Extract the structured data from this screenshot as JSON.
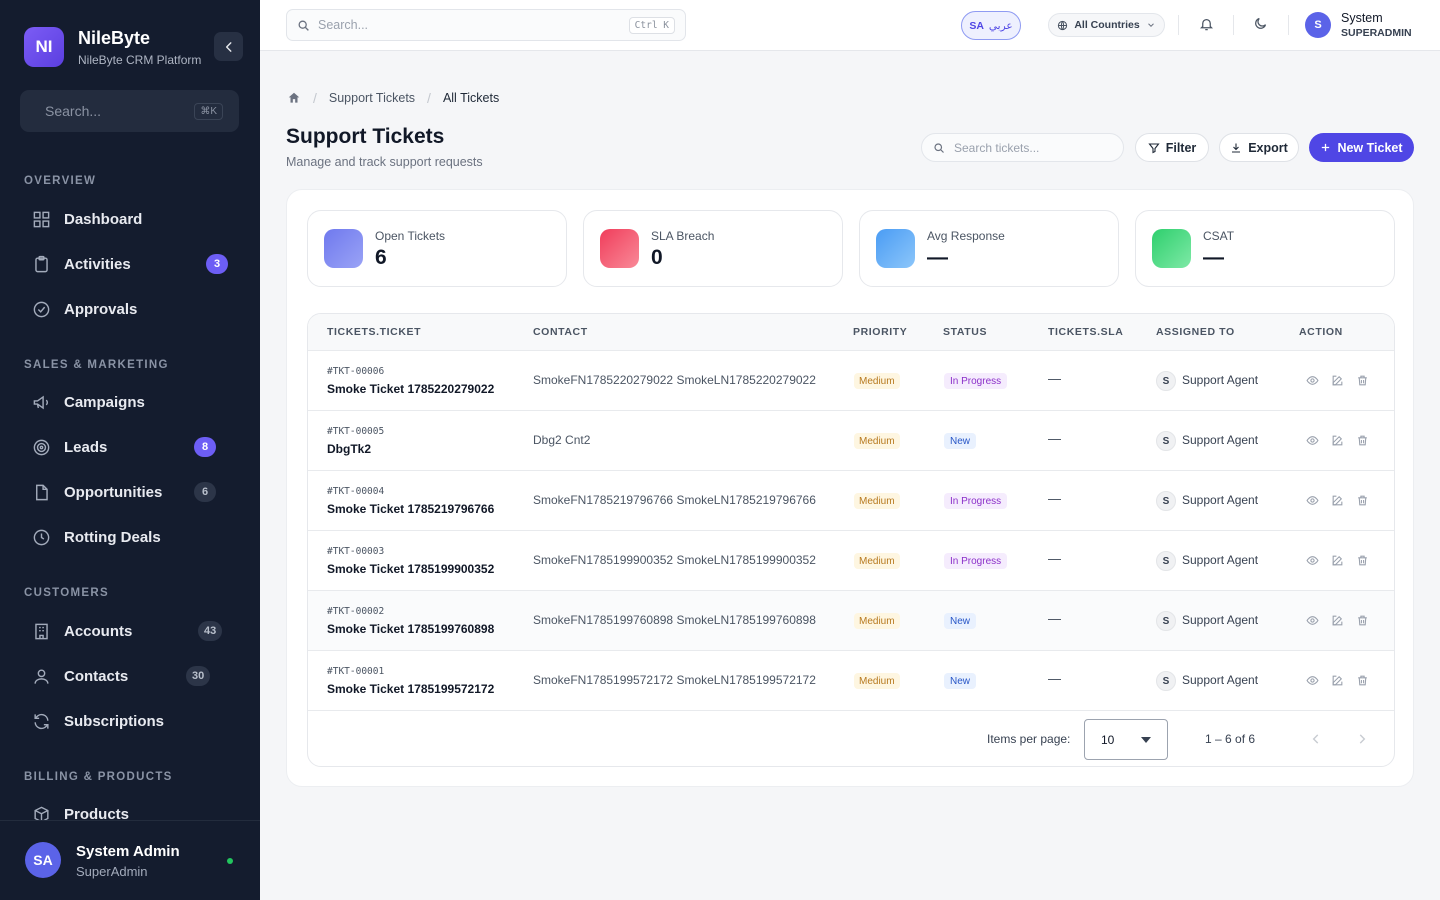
{
  "sidebar": {
    "logo": "NI",
    "brand_name": "NileByte",
    "brand_sub": "NileByte CRM Platform",
    "search_placeholder": "Search...",
    "search_kbd": "⌘K",
    "sections": {
      "overview": "OVERVIEW",
      "sales": "SALES & MARKETING",
      "customers": "CUSTOMERS",
      "billing": "BILLING & PRODUCTS"
    },
    "items": {
      "dashboard": {
        "label": "Dashboard",
        "icon": "grid-icon"
      },
      "activities": {
        "label": "Activities",
        "icon": "clipboard-icon",
        "badge": "3"
      },
      "approvals": {
        "label": "Approvals",
        "icon": "check-circle-icon"
      },
      "campaigns": {
        "label": "Campaigns",
        "icon": "megaphone-icon"
      },
      "leads": {
        "label": "Leads",
        "icon": "target-icon",
        "badge": "8"
      },
      "opportunities": {
        "label": "Opportunities",
        "icon": "file-icon",
        "badge": "6"
      },
      "rotting": {
        "label": "Rotting Deals",
        "icon": "clock-icon"
      },
      "accounts": {
        "label": "Accounts",
        "icon": "building-icon",
        "badge": "43"
      },
      "contacts": {
        "label": "Contacts",
        "icon": "user-icon",
        "badge": "30"
      },
      "subscriptions": {
        "label": "Subscriptions",
        "icon": "refresh-icon"
      },
      "products": {
        "label": "Products",
        "icon": "box-icon"
      }
    },
    "user": {
      "initials": "SA",
      "name": "System Admin",
      "role": "SuperAdmin",
      "status_color": "#22c55e"
    }
  },
  "topbar": {
    "search_placeholder": "Search...",
    "search_kbd": "Ctrl K",
    "lang_code": "SA",
    "lang_label": "عربي",
    "country": "All Countries",
    "user_initial": "S",
    "user_name": "System",
    "user_role": "SUPERADMIN"
  },
  "breadcrumb": {
    "section": "Support Tickets",
    "current": "All Tickets"
  },
  "page": {
    "title": "Support Tickets",
    "subtitle": "Manage and track support requests",
    "search_placeholder": "Search tickets...",
    "filter_label": "Filter",
    "export_label": "Export",
    "new_label": "New Ticket",
    "accent": "#4f46e5"
  },
  "stats": [
    {
      "label": "Open Tickets",
      "value": "6",
      "color": "#7b84ee"
    },
    {
      "label": "SLA Breach",
      "value": "0",
      "color": "#f2566b"
    },
    {
      "label": "Avg Response",
      "value": "—",
      "color": "#5aa8f5"
    },
    {
      "label": "CSAT",
      "value": "—",
      "color": "#45d97e"
    }
  ],
  "table": {
    "headers": {
      "ticket": "TICKETS.TICKET",
      "contact": "CONTACT",
      "priority": "PRIORITY",
      "status": "STATUS",
      "sla": "TICKETS.SLA",
      "assigned": "ASSIGNED TO",
      "action": "ACTION"
    },
    "rows": [
      {
        "number": "#TKT-00006",
        "subject": "Smoke Ticket 1785220279022",
        "contact": "SmokeFN1785220279022 SmokeLN1785220279022",
        "priority": "Medium",
        "status": "In Progress",
        "sla": "—",
        "agent_initial": "S",
        "agent": "Support Agent"
      },
      {
        "number": "#TKT-00005",
        "subject": "DbgTk2",
        "contact": "Dbg2 Cnt2",
        "priority": "Medium",
        "status": "New",
        "sla": "—",
        "agent_initial": "S",
        "agent": "Support Agent"
      },
      {
        "number": "#TKT-00004",
        "subject": "Smoke Ticket 1785219796766",
        "contact": "SmokeFN1785219796766 SmokeLN1785219796766",
        "priority": "Medium",
        "status": "In Progress",
        "sla": "—",
        "agent_initial": "S",
        "agent": "Support Agent"
      },
      {
        "number": "#TKT-00003",
        "subject": "Smoke Ticket 1785199900352",
        "contact": "SmokeFN1785199900352 SmokeLN1785199900352",
        "priority": "Medium",
        "status": "In Progress",
        "sla": "—",
        "agent_initial": "S",
        "agent": "Support Agent"
      },
      {
        "number": "#TKT-00002",
        "subject": "Smoke Ticket 1785199760898",
        "contact": "SmokeFN1785199760898 SmokeLN1785199760898",
        "priority": "Medium",
        "status": "New",
        "sla": "—",
        "agent_initial": "S",
        "agent": "Support Agent"
      },
      {
        "number": "#TKT-00001",
        "subject": "Smoke Ticket 1785199572172",
        "contact": "SmokeFN1785199572172 SmokeLN1785199572172",
        "priority": "Medium",
        "status": "New",
        "sla": "—",
        "agent_initial": "S",
        "agent": "Support Agent"
      }
    ],
    "pagination": {
      "items_per_page_label": "Items per page:",
      "page_size": "10",
      "range": "1 – 6 of 6"
    }
  }
}
